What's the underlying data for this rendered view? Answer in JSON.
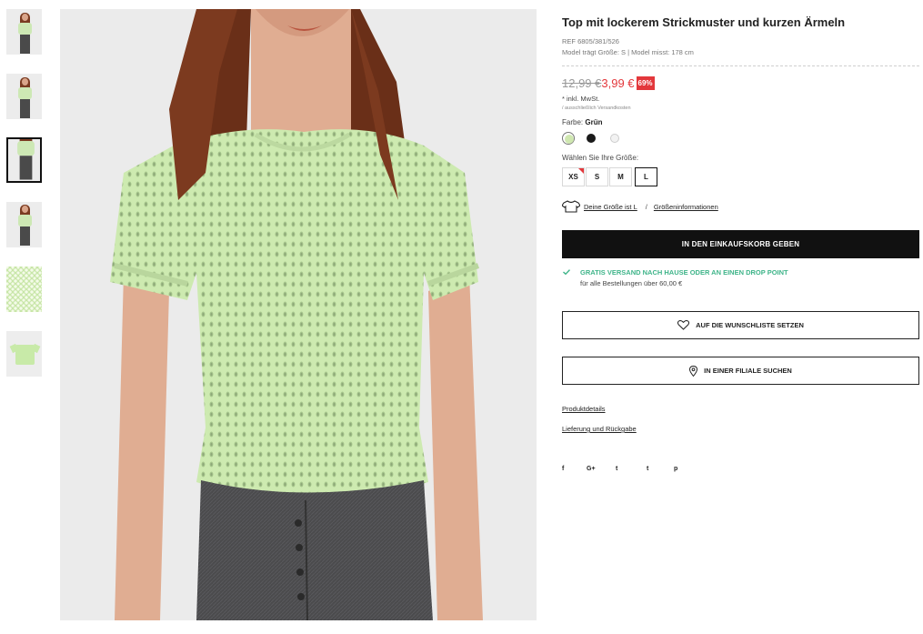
{
  "thumbnails": [
    {
      "name": "thumb-1",
      "kind": "model-front"
    },
    {
      "name": "thumb-2",
      "kind": "model-front"
    },
    {
      "name": "thumb-3",
      "kind": "model-closeup",
      "active": true
    },
    {
      "name": "thumb-4",
      "kind": "model-full"
    },
    {
      "name": "thumb-5",
      "kind": "fabric-detail"
    },
    {
      "name": "thumb-6",
      "kind": "flat-lay"
    }
  ],
  "product": {
    "title": "Top mit lockerem Strickmuster und kurzen Ärmeln",
    "ref": "REF 6805/381/526",
    "model_info": "Model trägt Größe: S | Model misst: 178 cm",
    "old_price": "12,99 €",
    "new_price": "3,99 €",
    "discount": "69%",
    "tax_note": "* inkl. MwSt.",
    "shipping_note": "/ ausschließlich Versandkosten",
    "color_label": "Farbe:",
    "color_value": "Grün",
    "colors": [
      {
        "name": "green",
        "hex": "#cfe7b0",
        "selected": true
      },
      {
        "name": "black",
        "hex": "#1a1a1a"
      },
      {
        "name": "white",
        "hex": "#f2f2f2"
      }
    ],
    "size_label": "Wählen Sie Ihre Größe:",
    "sizes": [
      {
        "label": "XS",
        "low_stock": true
      },
      {
        "label": "S"
      },
      {
        "label": "M"
      },
      {
        "label": "L",
        "selected": true
      }
    ],
    "size_hint": "Deine Größe ist L",
    "size_separator": "/",
    "size_info_link": "Größeninformationen"
  },
  "actions": {
    "add_to_cart": "IN DEN EINKAUFSKORB GEBEN",
    "wishlist": "AUF DIE WUNSCHLISTE SETZEN",
    "store_search": "IN EINER FILIALE SUCHEN"
  },
  "shipping": {
    "headline": "GRATIS VERSAND NACH HAUSE ODER AN EINEN DROP POINT",
    "subline": "für alle Bestellungen über 60,00 €"
  },
  "links": {
    "details": "Produktdetails",
    "returns": "Lieferung und Rückgabe"
  },
  "social": {
    "facebook": "f",
    "google": "G+",
    "twitter": "t",
    "tumblr": "t",
    "pinterest": "p"
  },
  "colors": {
    "accent_red": "#e3383c",
    "success_green": "#3eb489",
    "button_black": "#111111"
  }
}
